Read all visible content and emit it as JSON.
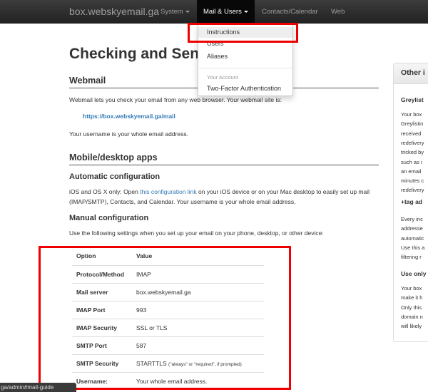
{
  "navbar": {
    "brand": "box.webskyemail.ga",
    "items": [
      "System",
      "Mail & Users",
      "Contacts/Calendar",
      "Web"
    ]
  },
  "dropdown": {
    "items": [
      "Instructions",
      "Users",
      "Aliases"
    ],
    "header": "Your Account",
    "account_items": [
      "Two-Factor Authentication"
    ]
  },
  "page": {
    "title": "Checking and Sen",
    "webmail": {
      "heading": "Webmail",
      "text": "Webmail lets you check your email from any web browser. Your webmail site is:",
      "link": "https://box.webskyemail.ga/mail",
      "username_note": "Your username is your whole email address."
    },
    "mobile": {
      "heading": "Mobile/desktop apps",
      "auto_heading": "Automatic configuration",
      "auto_text_pre": "iOS and OS X only: Open ",
      "auto_link": "this configuration link",
      "auto_text_post": " on your iOS device or on your Mac desktop to easily set up mail (IMAP/SMTP), Contacts, and Calendar. Your username is your whole email address.",
      "manual_heading": "Manual configuration",
      "manual_text": "Use the following settings when you set up your email on your phone, desktop, or other device:"
    },
    "table": {
      "headers": [
        "Option",
        "Value"
      ],
      "rows": [
        [
          "Protocol/Method",
          "IMAP"
        ],
        [
          "Mail server",
          "box.webskyemail.ga"
        ],
        [
          "IMAP Port",
          "993"
        ],
        [
          "IMAP Security",
          "SSL or TLS"
        ],
        [
          "SMTP Port",
          "587"
        ],
        [
          "SMTP Security",
          "STARTTLS"
        ],
        [
          "Username:",
          "Your whole email address."
        ]
      ],
      "smtp_note": "(\"always\" or \"required\", if prompted)"
    }
  },
  "sidebar": {
    "title": "Other i",
    "sections": [
      {
        "heading": "Greylist",
        "lines": [
          "Your box",
          "Greylistin",
          "received",
          "redelivery",
          "tricked by",
          "such as i",
          "an email",
          "minutes c",
          "redelivery"
        ]
      },
      {
        "heading": "+tag ad",
        "lines": [
          "Every inc",
          "addresse",
          "automatic",
          "Use this a",
          "filtering r"
        ]
      },
      {
        "heading": "Use only",
        "lines": [
          "Your box",
          "make it h",
          "Only this",
          "domain n",
          "will likely"
        ]
      }
    ]
  },
  "statusbar": {
    "url": "ga/admin#mail-guide"
  }
}
